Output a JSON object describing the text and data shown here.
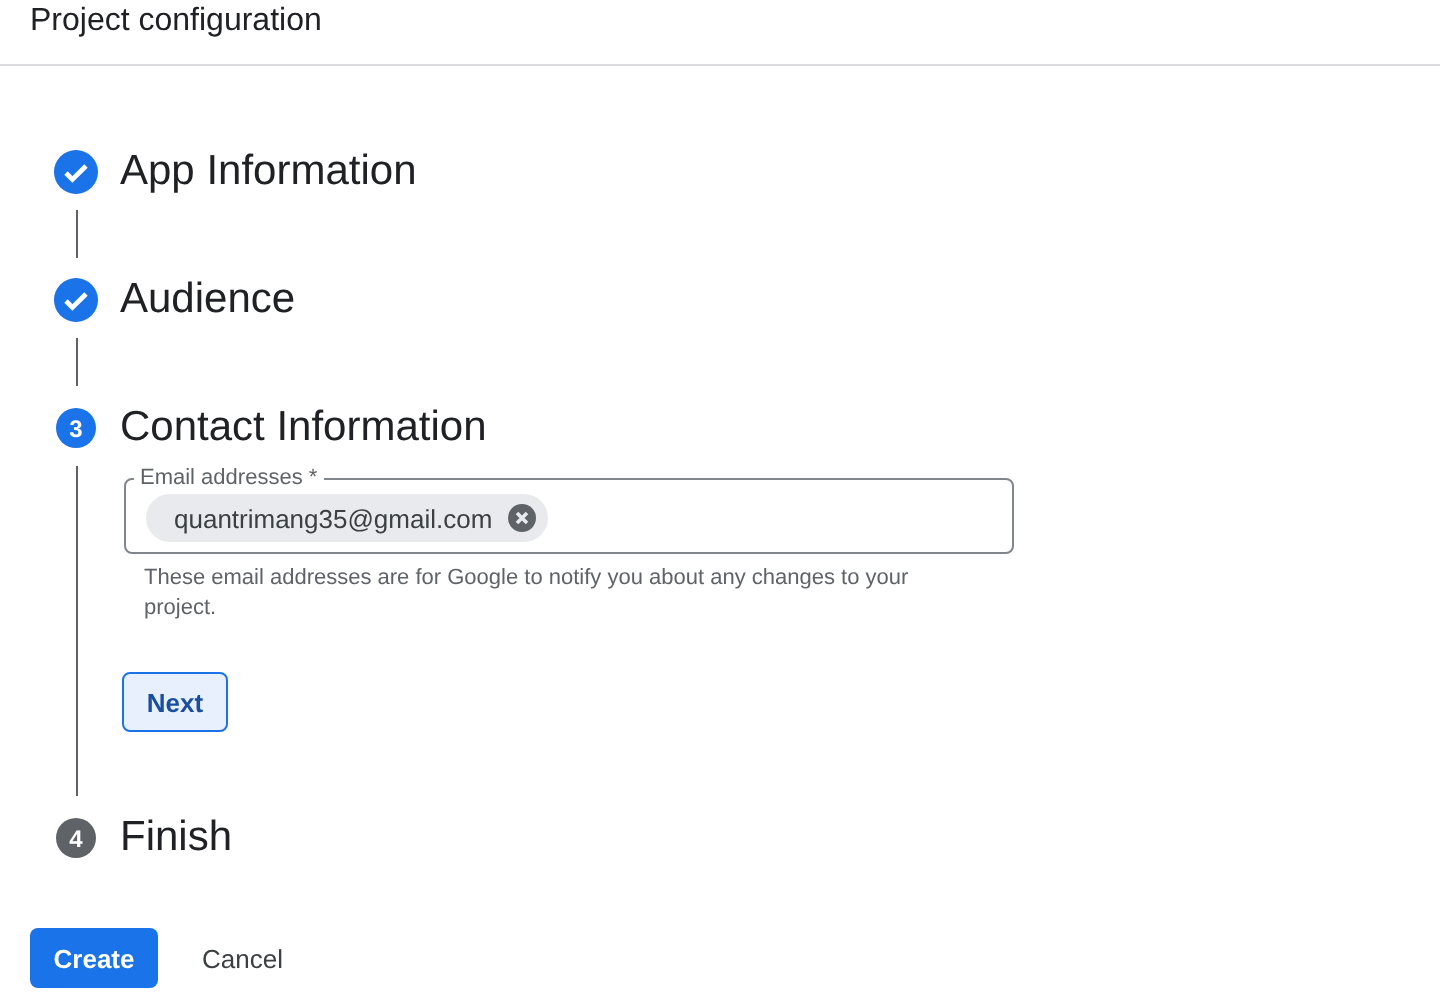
{
  "header": {
    "title": "Project configuration"
  },
  "steps": [
    {
      "kind": "done",
      "title": "App Information"
    },
    {
      "kind": "done",
      "title": "Audience"
    },
    {
      "kind": "active",
      "number": "3",
      "title": "Contact Information",
      "field": {
        "label": "Email addresses *",
        "chips": [
          "quantrimang35@gmail.com"
        ],
        "helper": "These email addresses are for Google to notify you about any changes to your project."
      },
      "next_button": "Next"
    },
    {
      "kind": "pending",
      "number": "4",
      "title": "Finish"
    }
  ],
  "actions": {
    "primary": "Create",
    "secondary": "Cancel"
  }
}
